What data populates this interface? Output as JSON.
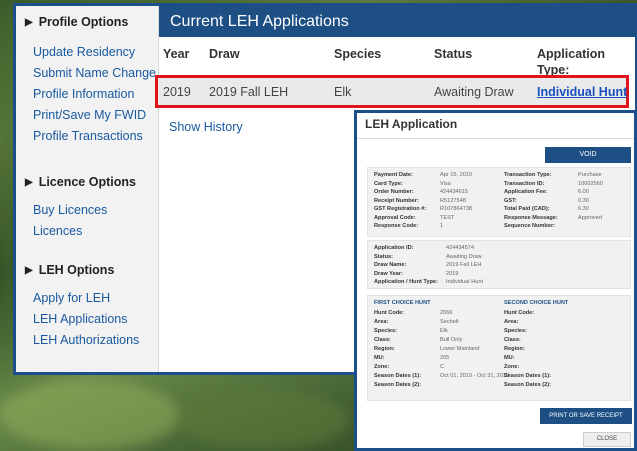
{
  "sidebar": {
    "profile": {
      "heading": "Profile Options",
      "items": [
        "Update Residency",
        "Submit Name Change",
        "Profile Information",
        "Print/Save My FWID",
        "Profile Transactions"
      ]
    },
    "licence": {
      "heading": "Licence Options",
      "items": [
        "Buy Licences",
        "Licences"
      ]
    },
    "leh": {
      "heading": "LEH Options",
      "items": [
        "Apply for LEH",
        "LEH Applications",
        "LEH Authorizations"
      ]
    }
  },
  "main": {
    "title": "Current LEH Applications",
    "columns": [
      "Year",
      "Draw",
      "Species",
      "Status",
      "Application",
      "Type:"
    ],
    "row": {
      "year": "2019",
      "draw": "2019 Fall LEH",
      "species": "Elk",
      "status": "Awaiting Draw",
      "app_type": "Individual Hunt"
    },
    "show_history": "Show History"
  },
  "modal": {
    "title": "LEH Application",
    "void_label": "VOID",
    "payment_left": [
      [
        "Payment Date:",
        "Apr 15, 2019"
      ],
      [
        "Card Type:",
        "Visa"
      ],
      [
        "Order Number:",
        "424434615"
      ],
      [
        "Receipt Number:",
        "R5127548"
      ],
      [
        "GST Registration #:",
        "R107864738"
      ],
      [
        "Approval Code:",
        "TEST"
      ],
      [
        "Response Code:",
        "1"
      ]
    ],
    "payment_right": [
      [
        "Transaction Type:",
        "Purchase"
      ],
      [
        "Transaction ID:",
        "10002560"
      ],
      [
        "Application Fee:",
        "6.00"
      ],
      [
        "GST:",
        "0.30"
      ],
      [
        "Total Paid (CAD):",
        "6.30"
      ],
      [
        "Response Message:",
        "Approved"
      ],
      [
        "Sequence Number:",
        ""
      ]
    ],
    "app_info": [
      [
        "Application ID:",
        "424434574"
      ],
      [
        "Status:",
        "Awaiting Draw"
      ],
      [
        "Draw Name:",
        "2019 Fall LEH"
      ],
      [
        "Draw Year:",
        "2019"
      ],
      [
        "Application / Hunt Type:",
        "Individual Hunt"
      ]
    ],
    "first_choice_heading": "FIRST CHOICE HUNT",
    "second_choice_heading": "SECOND CHOICE HUNT",
    "first_choice": [
      [
        "Hunt Code:",
        "2066"
      ],
      [
        "Area:",
        "Sechelt"
      ],
      [
        "Species:",
        "Elk"
      ],
      [
        "Class:",
        "Bull Only"
      ],
      [
        "Region:",
        "Lower Mainland"
      ],
      [
        "MU:",
        "205"
      ],
      [
        "Zone:",
        "C"
      ],
      [
        "Season Dates (1):",
        "Oct 01, 2019 - Oct 31, 2019"
      ],
      [
        "Season Dates (2):",
        ""
      ]
    ],
    "second_choice": [
      [
        "Hunt Code:",
        ""
      ],
      [
        "Area:",
        ""
      ],
      [
        "Species:",
        ""
      ],
      [
        "Class:",
        ""
      ],
      [
        "Region:",
        ""
      ],
      [
        "MU:",
        ""
      ],
      [
        "Zone:",
        ""
      ],
      [
        "Season Dates (1):",
        ""
      ],
      [
        "Season Dates (2):",
        ""
      ]
    ],
    "print_label": "PRINT OR SAVE RECEIPT",
    "close_label": "CLOSE"
  }
}
